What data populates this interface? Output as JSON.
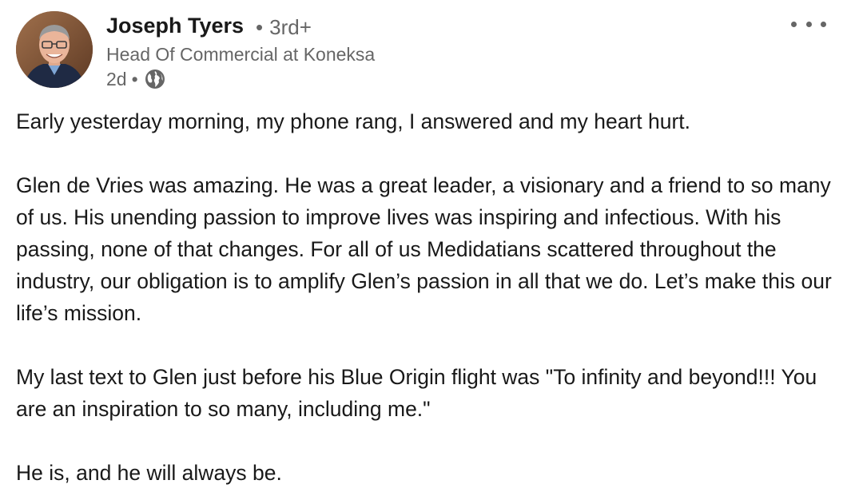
{
  "author": {
    "name": "Joseph Tyers",
    "connection_degree": "3rd+",
    "headline": "Head Of Commercial at Koneksa",
    "time_ago": "2d",
    "visibility_icon": "globe-icon"
  },
  "menu": {
    "icon": "more-horizontal-icon"
  },
  "post": {
    "paragraphs": [
      "Early yesterday morning, my phone rang, I answered and my heart hurt.",
      "Glen de Vries was amazing. He was a great leader, a visionary and a friend to so many of us. His unending passion to improve lives was inspiring and infectious. With his passing, none of that changes. For all of us Medidatians scattered throughout the industry, our obligation is to amplify Glen’s passion in all that we do. Let’s make this our life’s mission.",
      "My last text to Glen just before his Blue Origin flight was \"To infinity and beyond!!! You are an inspiration to so many, including me.\"",
      "He is, and he will always be."
    ]
  },
  "colors": {
    "primary_text": "#191919",
    "secondary_text": "#666666",
    "background": "#ffffff"
  }
}
